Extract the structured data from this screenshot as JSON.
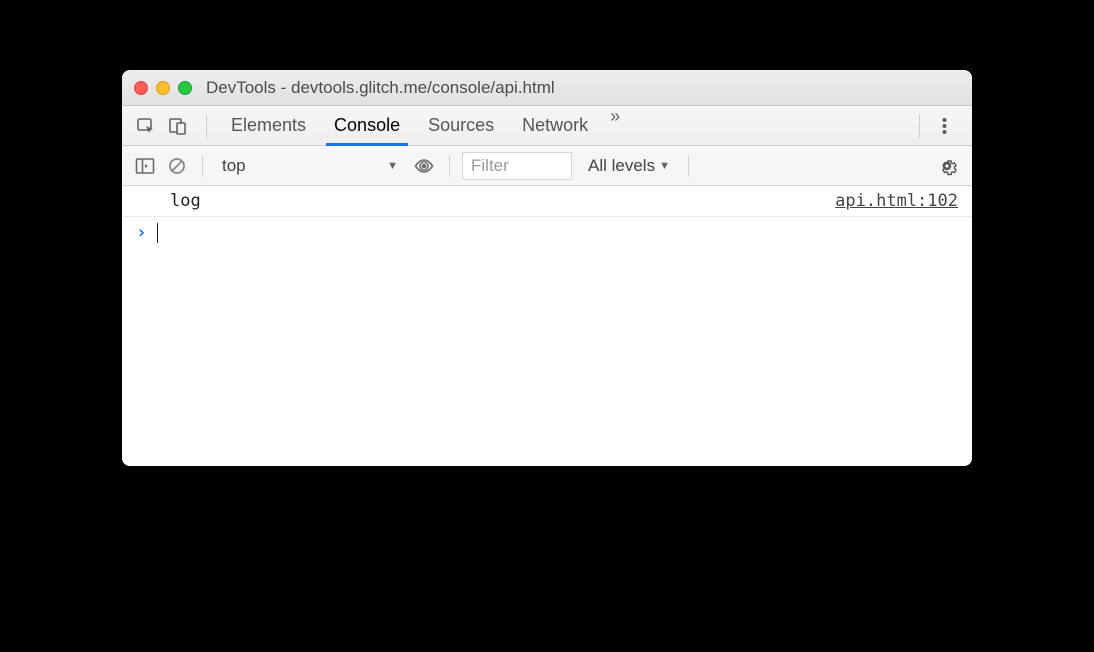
{
  "window": {
    "title": "DevTools - devtools.glitch.me/console/api.html"
  },
  "tabs": {
    "elements": "Elements",
    "console": "Console",
    "sources": "Sources",
    "network": "Network",
    "more": "»"
  },
  "toolbar": {
    "context": "top",
    "context_caret": "▼",
    "filter_placeholder": "Filter",
    "levels_label": "All levels",
    "levels_caret": "▼"
  },
  "console": {
    "log_text": "log",
    "source_link": "api.html:102",
    "prompt": "›"
  }
}
